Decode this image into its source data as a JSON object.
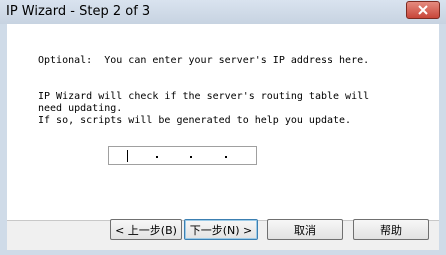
{
  "window": {
    "title": "IP Wizard - Step 2 of 3"
  },
  "content": {
    "optional_text": "Optional:  You can enter your server's IP address here.",
    "line1": "IP Wizard will check if the server's routing table will",
    "line2": "need updating.",
    "line3": "If so, scripts will be generated to help you update."
  },
  "ip_input": {
    "value": ""
  },
  "buttons": {
    "back": "< 上一步(B)",
    "next": "下一步(N) >",
    "cancel": "取消",
    "help": "帮助"
  },
  "icons": {
    "close": "close-icon"
  }
}
